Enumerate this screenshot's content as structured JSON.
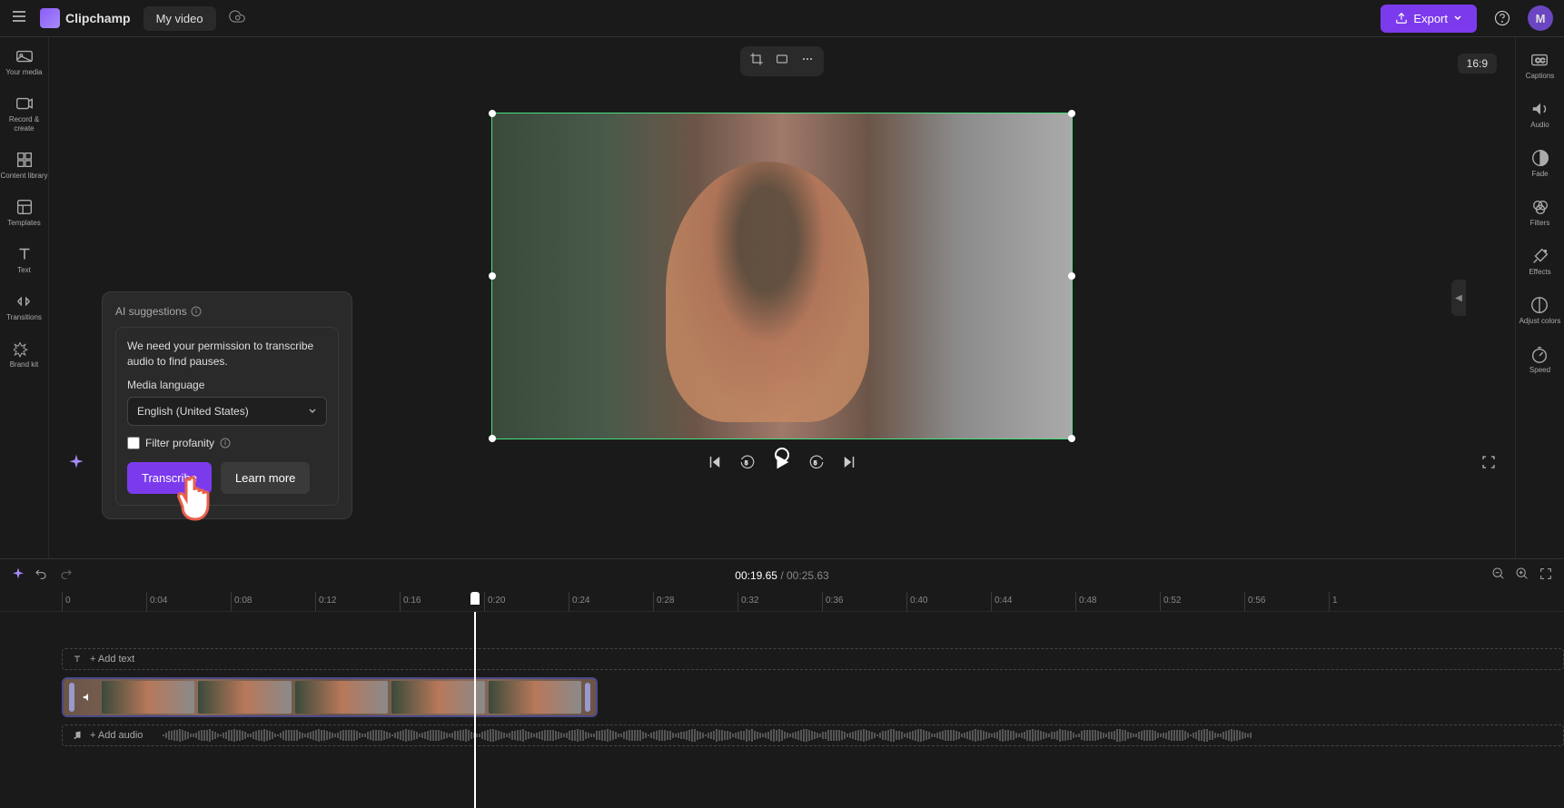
{
  "header": {
    "app_name": "Clipchamp",
    "project_name": "My video",
    "export_label": "Export",
    "aspect_ratio": "16:9",
    "avatar_initial": "M"
  },
  "sidebar_left": {
    "items": [
      {
        "label": "Your media"
      },
      {
        "label": "Record & create"
      },
      {
        "label": "Content library"
      },
      {
        "label": "Templates"
      },
      {
        "label": "Text"
      },
      {
        "label": "Transitions"
      },
      {
        "label": "Brand kit"
      }
    ]
  },
  "sidebar_right": {
    "items": [
      {
        "label": "Captions"
      },
      {
        "label": "Audio"
      },
      {
        "label": "Fade"
      },
      {
        "label": "Filters"
      },
      {
        "label": "Effects"
      },
      {
        "label": "Adjust colors"
      },
      {
        "label": "Speed"
      }
    ]
  },
  "ai_panel": {
    "title": "AI suggestions",
    "permission_text": "We need your permission to transcribe audio to find pauses.",
    "language_label": "Media language",
    "language_value": "English (United States)",
    "filter_label": "Filter profanity",
    "transcribe_btn": "Transcribe",
    "learnmore_btn": "Learn more"
  },
  "timeline": {
    "current_time": "00:19.65",
    "total_time": "00:25.63",
    "ticks": [
      "0",
      "0:04",
      "0:08",
      "0:12",
      "0:16",
      "0:20",
      "0:24",
      "0:28",
      "0:32",
      "0:36",
      "0:40",
      "0:44",
      "0:48",
      "0:52",
      "0:56",
      "1"
    ],
    "add_text_label": "+ Add text",
    "add_audio_label": "+ Add audio"
  }
}
